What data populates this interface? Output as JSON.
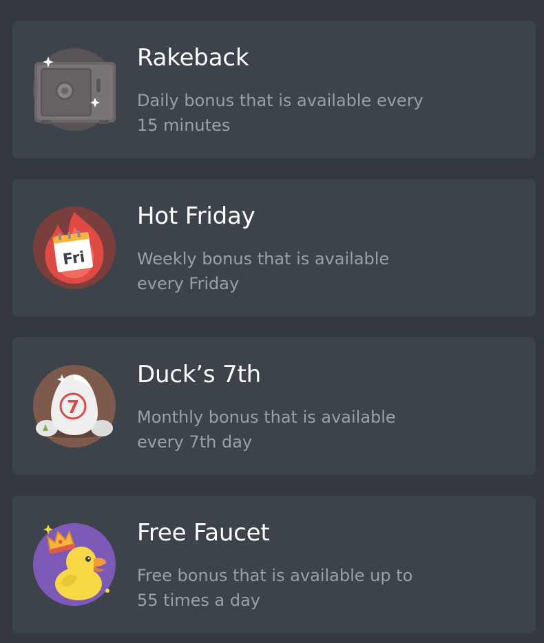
{
  "bonuses": [
    {
      "title": "Rakeback",
      "description": "Daily bonus that is available every 15 minutes",
      "icon": "safe-icon",
      "icon_bg": "#5a5356"
    },
    {
      "title": "Hot Friday",
      "description": "Weekly bonus that is available every Friday",
      "icon": "fire-calendar-icon",
      "icon_bg": "#7a3e3c",
      "icon_text": "Fri"
    },
    {
      "title": "Duck’s 7th",
      "description": "Monthly bonus that is available every 7th day",
      "icon": "egg-seven-icon",
      "icon_bg": "#7d5a4c",
      "icon_text": "7"
    },
    {
      "title": "Free Faucet",
      "description": "Free bonus that is available up to 55 times a day",
      "icon": "crowned-duck-icon",
      "icon_bg": "#7e5ab8"
    }
  ],
  "colors": {
    "page_bg": "#343941",
    "card_bg": "#3d434b",
    "title": "#ffffff",
    "description": "#9aa0a8"
  }
}
